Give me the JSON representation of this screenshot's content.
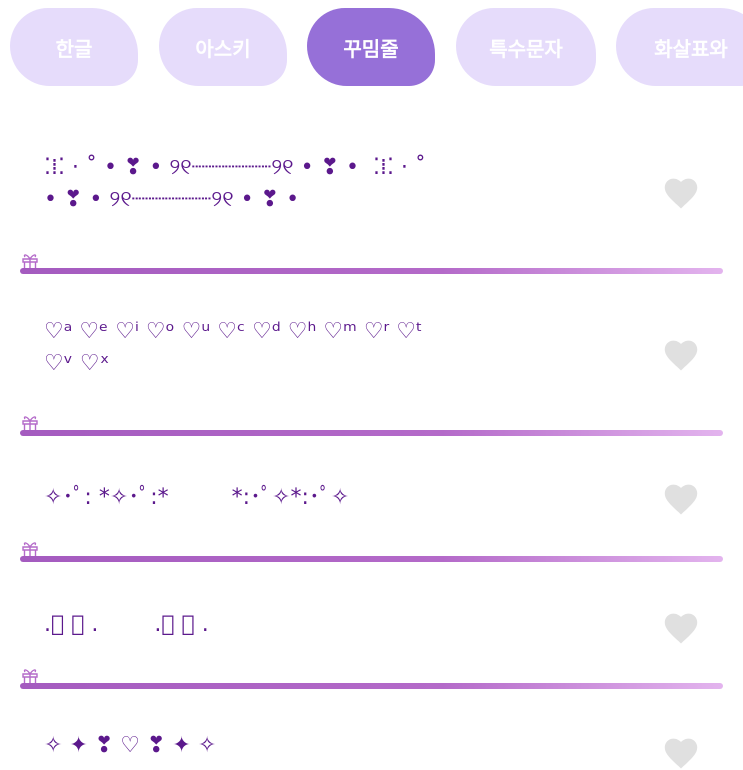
{
  "tabs": [
    {
      "label": "한글",
      "active": false
    },
    {
      "label": "아스키",
      "active": false
    },
    {
      "label": "꾸밈줄",
      "active": true
    },
    {
      "label": "특수문자",
      "active": false
    },
    {
      "label": "화살표와",
      "active": false
    }
  ],
  "rows": [
    {
      "text": "⁚⁞⁚ ⋅ ˚ • ❣ • ୨୧┈┈┈┈┈┈୨୧ • ❣ •  ⁚⁞⁚ ⋅ ˚\n• ❣ • ୨୧┈┈┈┈┈┈୨୧ • ❣ •"
    },
    {
      "text": "♡ᵃ ♡ᵉ ♡ⁱ ♡ᵒ ♡ᵘ ♡ᶜ ♡ᵈ ♡ʰ ♡ᵐ ♡ʳ ♡ᵗ\n♡ᵛ ♡ˣ"
    },
    {
      "text": "✧･ﾟ: *✧･ﾟ:*         *:･ﾟ✧*:･ﾟ✧"
    },
    {
      "text": ".ﾟ ﾟ .        .ﾟ ﾟ ."
    },
    {
      "text": "✧ ✦ ❣ ♡ ❣ ✦ ✧"
    }
  ],
  "colors": {
    "tab_inactive": "#e6dcfb",
    "tab_active": "#9670d8",
    "text": "#5b188c",
    "heart": "#e0e0e0",
    "divider_start": "#a45bbf",
    "divider_end": "#e3b4ee"
  },
  "icons": {
    "favorite": "heart-icon",
    "divider_deco": "gift-icon"
  }
}
